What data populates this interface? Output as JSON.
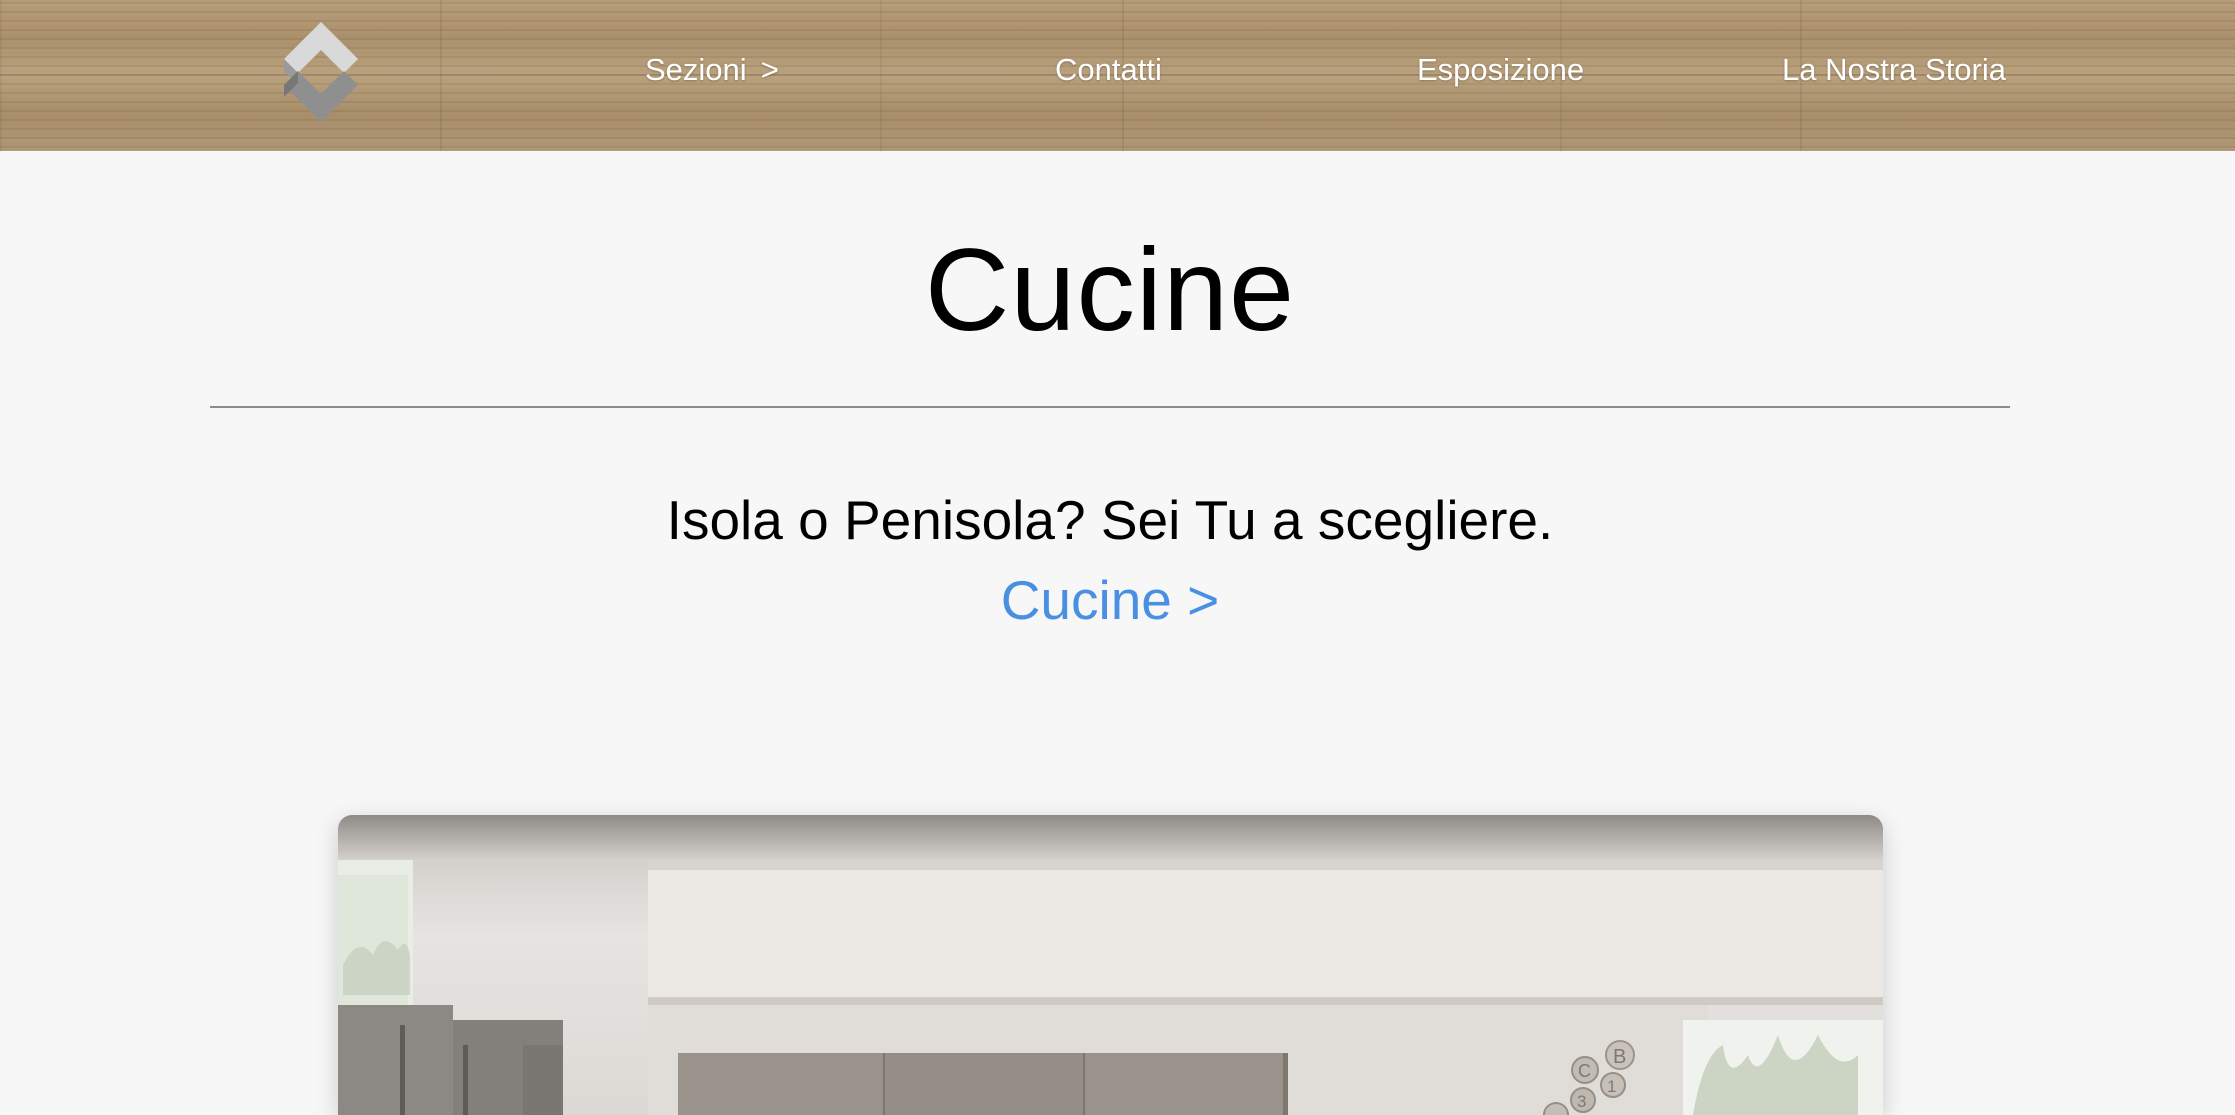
{
  "nav": {
    "logo_icon": "brand-diamond-logo",
    "items": [
      {
        "label": "Sezioni",
        "arrow": ">"
      },
      {
        "label": "Contatti"
      },
      {
        "label": "Esposizione"
      },
      {
        "label": "La Nostra Storia"
      }
    ]
  },
  "main": {
    "title": "Cucine",
    "tagline": "Isola o Penisola? Sei Tu a scegliere.",
    "cta_label": "Cucine >",
    "hero_image": "kitchen-photo"
  },
  "colors": {
    "link": "#4a90e2",
    "background": "#f7f7f7",
    "nav_wood": "#ad9370"
  }
}
